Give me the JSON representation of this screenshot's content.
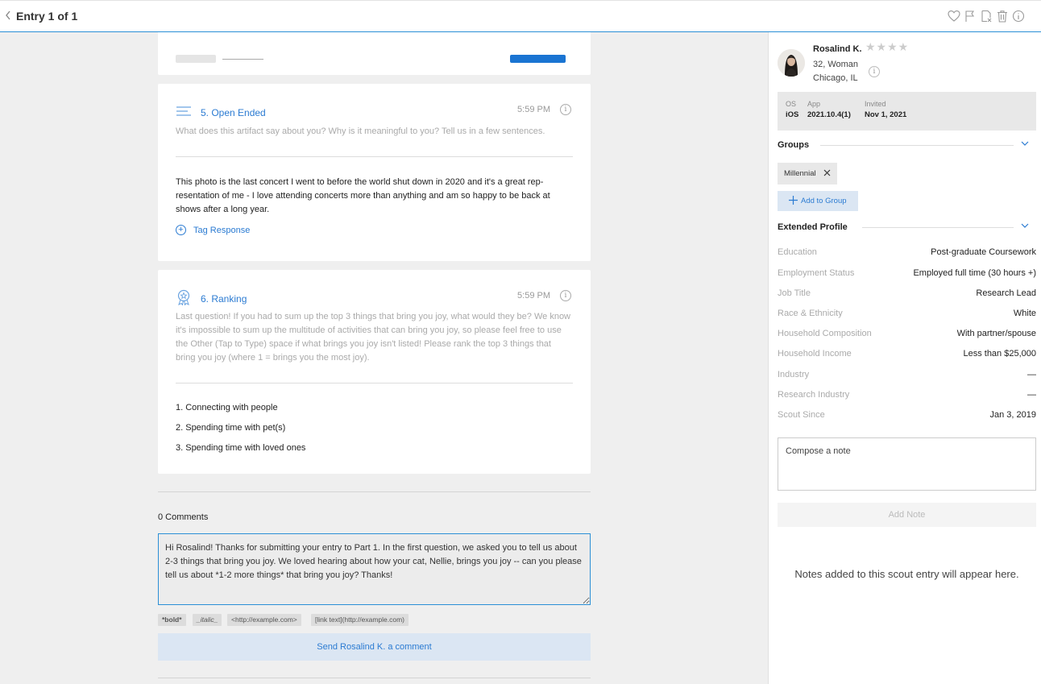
{
  "header": {
    "title": "Entry 1 of 1"
  },
  "questions": [
    {
      "title": "5. Open Ended",
      "time": "5:59 PM",
      "prompt": "What does this artifact say about you? Why is it meaningful to you? Tell us in a few sentences.",
      "answer": "This photo is the last concert I went to before the world shut down in 2020 and it's a great rep-resentation of me - I love attending concerts more than anything and am so happy to be back at shows after a long year.",
      "tag_label": "Tag Response"
    },
    {
      "title": "6. Ranking",
      "time": "5:59 PM",
      "prompt": "Last question! If you had to sum up the top 3 things that bring you joy, what would they be? We know it's impossible to sum up the multitude of activities that can bring you joy, so please feel free to use the Other (Tap to Type) space if what brings you joy isn't listed! Please rank the top 3 things that bring you joy (where 1 = brings you the most joy).",
      "rankings": [
        "1. Connecting with people",
        "2. Spending time with pet(s)",
        "3. Spending time with loved ones"
      ]
    }
  ],
  "comments": {
    "count_label": "0 Comments",
    "draft": "Hi Rosalind! Thanks for submitting your entry to Part 1. In the first question, we asked you to tell us about 2-3 things that bring you joy. We loved hearing about how your cat, Nellie, brings you joy -- can you please tell us about *1-2 more things* that bring you joy? Thanks!",
    "format_hints": [
      "*bold*",
      "_italic_",
      "<http://example.com>",
      "[link text](http://example.com)"
    ],
    "send_label": "Send Rosalind K. a comment"
  },
  "profile": {
    "name": "Rosalind K.",
    "rating": 0,
    "age_gender": "32, Woman",
    "location": "Chicago, IL",
    "meta": [
      {
        "label": "OS",
        "value": "iOS"
      },
      {
        "label": "App",
        "value": "2021.10.4(1)"
      },
      {
        "label": "Invited",
        "value": "Nov 1, 2021"
      }
    ]
  },
  "groups": {
    "title": "Groups",
    "items": [
      "Millennial"
    ],
    "add_label": "Add to Group"
  },
  "extended_profile": {
    "title": "Extended Profile",
    "rows": [
      {
        "label": "Education",
        "value": "Post-graduate Coursework"
      },
      {
        "label": "Employment Status",
        "value": "Employed full time (30 hours +)"
      },
      {
        "label": "Job Title",
        "value": "Research Lead"
      },
      {
        "label": "Race & Ethnicity",
        "value": "White"
      },
      {
        "label": "Household Composition",
        "value": "With partner/spouse"
      },
      {
        "label": "Household Income",
        "value": "Less than $25,000"
      },
      {
        "label": "Industry",
        "value": "—"
      },
      {
        "label": "Research Industry",
        "value": "—"
      },
      {
        "label": "Scout Since",
        "value": "Jan 3, 2019"
      }
    ]
  },
  "notes": {
    "placeholder": "Compose a note",
    "add_label": "Add Note",
    "empty_text": "Notes added to this scout entry will appear here."
  },
  "icons": {
    "toolbar": [
      "heart-icon",
      "flag-icon",
      "export-icon",
      "trash-icon",
      "info-icon"
    ],
    "question_5": "lines-icon",
    "question_6": "award-icon"
  },
  "colors": {
    "accent": "#2b7bd2",
    "primary_button": "#1a74d2"
  }
}
